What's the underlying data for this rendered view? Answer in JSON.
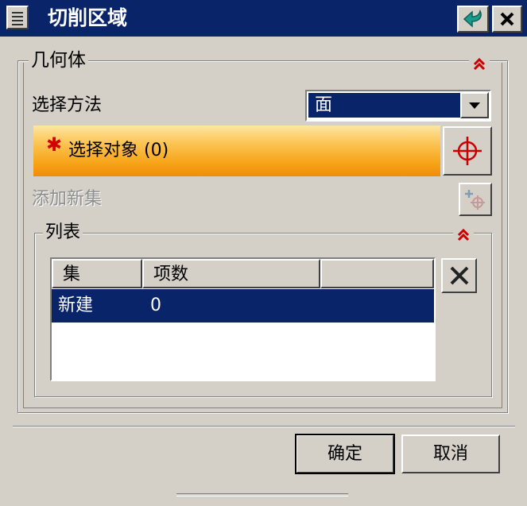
{
  "window": {
    "title": "切削区域"
  },
  "geometry_group": {
    "legend": "几何体",
    "select_method": {
      "label": "选择方法",
      "value": "面"
    },
    "select_object": {
      "label": "选择对象 (0)"
    },
    "add_new_set": {
      "label": "添加新集"
    }
  },
  "list_group": {
    "legend": "列表",
    "columns": [
      "集",
      "项数",
      ""
    ],
    "rows": [
      {
        "set": "新建",
        "count": "0"
      }
    ]
  },
  "footer": {
    "ok_label": "确定",
    "cancel_label": "取消"
  },
  "colors": {
    "titlebar": "#0a246a",
    "selection_bar": "#f7a316",
    "required_star": "#d40000",
    "crosshair": "#cc0000"
  },
  "icons": [
    "menu-icon",
    "back-icon",
    "close-icon",
    "collapse-icon",
    "dropdown-arrow-icon",
    "crosshair-icon",
    "add-set-icon",
    "delete-icon",
    "required-star-icon"
  ]
}
